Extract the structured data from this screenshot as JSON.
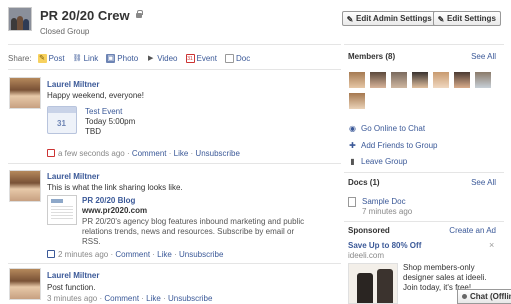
{
  "header": {
    "title": "PR 20/20 Crew",
    "privacy": "Closed Group",
    "edit_admin_label": "Edit Admin Settings",
    "edit_settings_label": "Edit Settings"
  },
  "share": {
    "label": "Share:",
    "items": [
      {
        "label": "Post",
        "icon": "post-icon"
      },
      {
        "label": "Link",
        "icon": "link-icon"
      },
      {
        "label": "Photo",
        "icon": "photo-icon"
      },
      {
        "label": "Video",
        "icon": "video-icon"
      },
      {
        "label": "Event",
        "icon": "event-icon"
      },
      {
        "label": "Doc",
        "icon": "doc-icon"
      }
    ]
  },
  "posts": [
    {
      "author": "Laurel Miltner",
      "text": "Happy weekend, everyone!",
      "event": {
        "title": "Test Event",
        "time": "Today 5:00pm",
        "location": "TBD",
        "cal_num": "31"
      },
      "time": "a few seconds ago",
      "comment": "Comment",
      "like": "Like",
      "unsubscribe": "Unsubscribe"
    },
    {
      "author": "Laurel Miltner",
      "text": "This is what the link sharing looks like.",
      "link": {
        "title": "PR 20/20 Blog",
        "url": "www.pr2020.com",
        "description": "PR 20/20's agency blog features inbound marketing and public relations trends, news and resources. Subscribe by email or RSS."
      },
      "time": "2 minutes ago",
      "comment": "Comment",
      "like": "Like",
      "unsubscribe": "Unsubscribe"
    },
    {
      "author": "Laurel Miltner",
      "text": "Post function.",
      "time": "3 minutes ago",
      "comment": "Comment",
      "like": "Like",
      "unsubscribe": "Unsubscribe"
    }
  ],
  "sidebar": {
    "members_title": "Members (8)",
    "members_see_all": "See All",
    "actions": [
      {
        "label": "Go Online to Chat",
        "icon": "chat-icon"
      },
      {
        "label": "Add Friends to Group",
        "icon": "add-friend-icon"
      },
      {
        "label": "Leave Group",
        "icon": "leave-icon"
      }
    ],
    "docs_title": "Docs (1)",
    "docs_see_all": "See All",
    "doc": {
      "title": "Sample Doc",
      "time": "7 minutes ago"
    },
    "sponsored_title": "Sponsored",
    "create_ad": "Create an Ad",
    "ad": {
      "title": "Save Up to 80% Off",
      "domain": "ideeli.com",
      "text": "Shop members-only designer sales at ideeli. Join today, it's free!"
    }
  },
  "chat": {
    "label": "Chat (Offline)"
  },
  "colors": {
    "link": "#3b5998",
    "text": "#333333",
    "meta": "#888888"
  }
}
